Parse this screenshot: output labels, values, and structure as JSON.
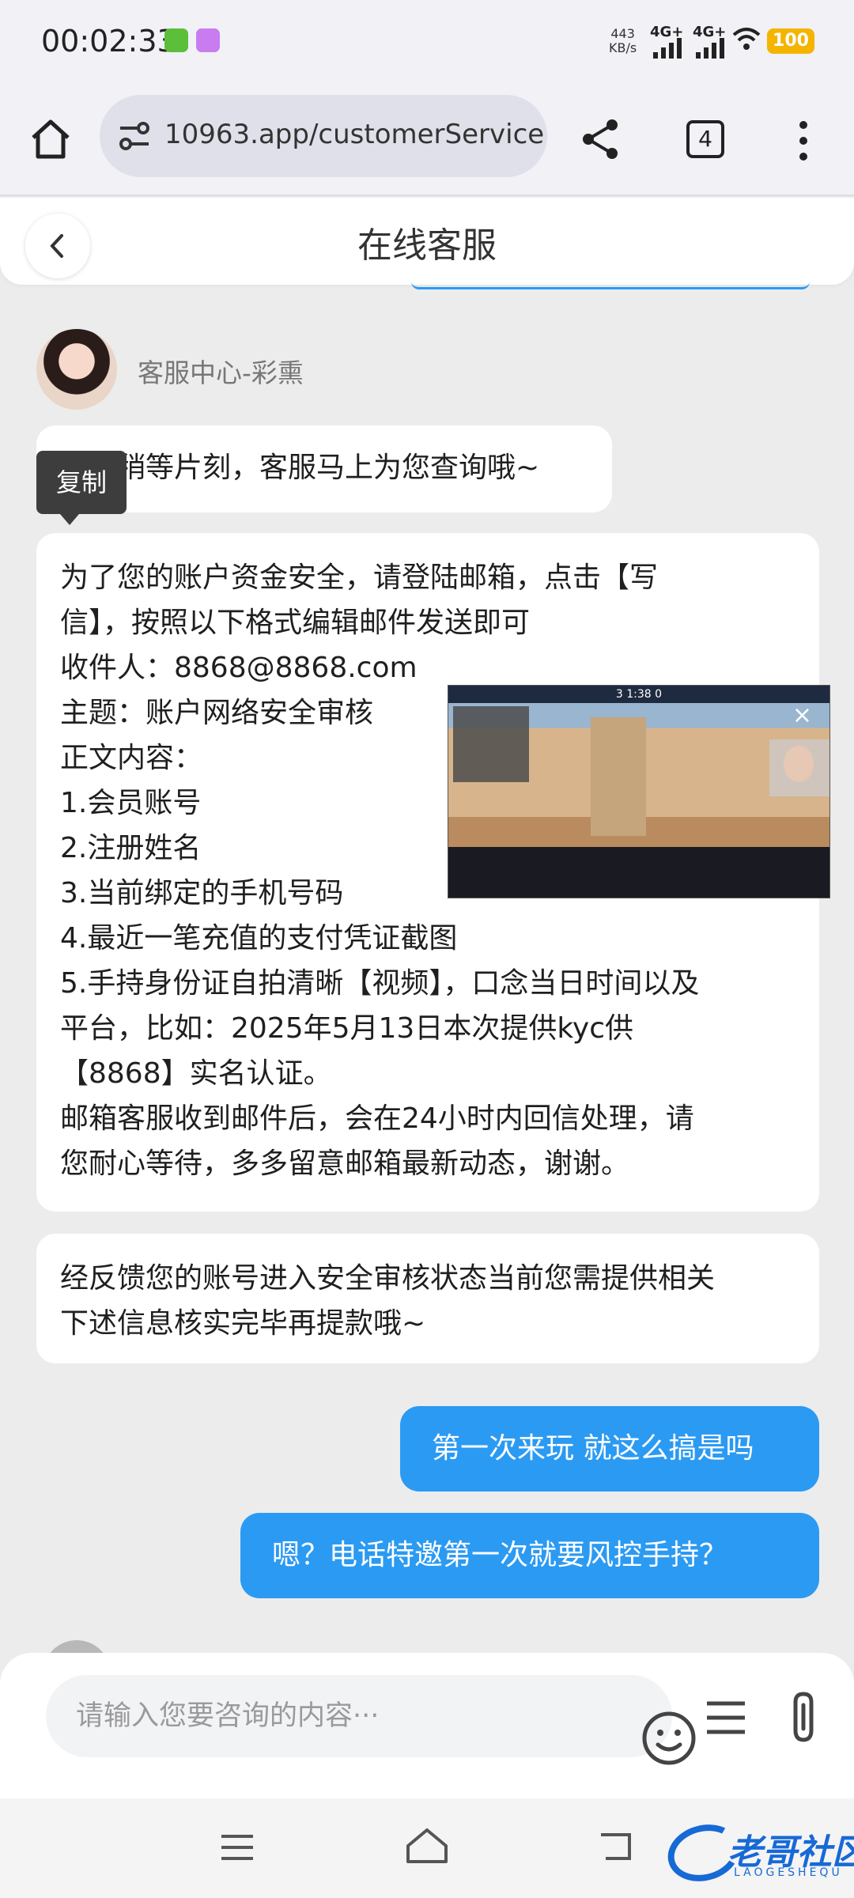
{
  "status_bar": {
    "time": "00:02:33",
    "net_speed_value": "443",
    "net_speed_unit": "KB/s",
    "signal1_label": "4G+",
    "signal2_label": "4G+",
    "battery": "100",
    "battery_color": "#f5b400"
  },
  "browser": {
    "url": "10963.app/customerService",
    "tab_count": "4"
  },
  "page": {
    "title": "在线客服"
  },
  "chat": {
    "agent_name": "客服中心-彩熏",
    "copy_tooltip": "复制",
    "messages": [
      {
        "from": "agent",
        "text": "请您稍等片刻，客服马上为您查询哦~"
      },
      {
        "from": "agent",
        "text": "为了您的账户资金安全，请登陆邮箱，点击【写\n信】，按照以下格式编辑邮件发送即可\n收件人：8868@8868.com\n主题：账户网络安全审核\n正文内容：\n1.会员账号\n2.注册姓名\n3.当前绑定的手机号码\n4.最近一笔充值的支付凭证截图\n5.手持身份证自拍清晰【视频】，口念当日时间以及\n平台，比如：2025年5月13日本次提供kyc供\n【8868】实名认证。\n邮箱客服收到邮件后，会在24小时内回信处理，请\n您耐心等待，多多留意邮箱最新动态，谢谢。"
      },
      {
        "from": "agent",
        "text": "经反馈您的账号进入安全审核状态当前您需提供相关\n下述信息核实完毕再提款哦~"
      },
      {
        "from": "user",
        "text": "第一次来玩 就这么搞是吗"
      },
      {
        "from": "user",
        "text": "嗯？电话特邀第一次就要风控手持？"
      }
    ],
    "user_bubble_color": "#2b9af3"
  },
  "video_overlay": {
    "hud_text": "3 1:38 0"
  },
  "input": {
    "placeholder": "请输入您要咨询的内容···",
    "value": ""
  },
  "watermark": {
    "text": "老哥社区",
    "subtext": "LAOGESHEQU"
  }
}
